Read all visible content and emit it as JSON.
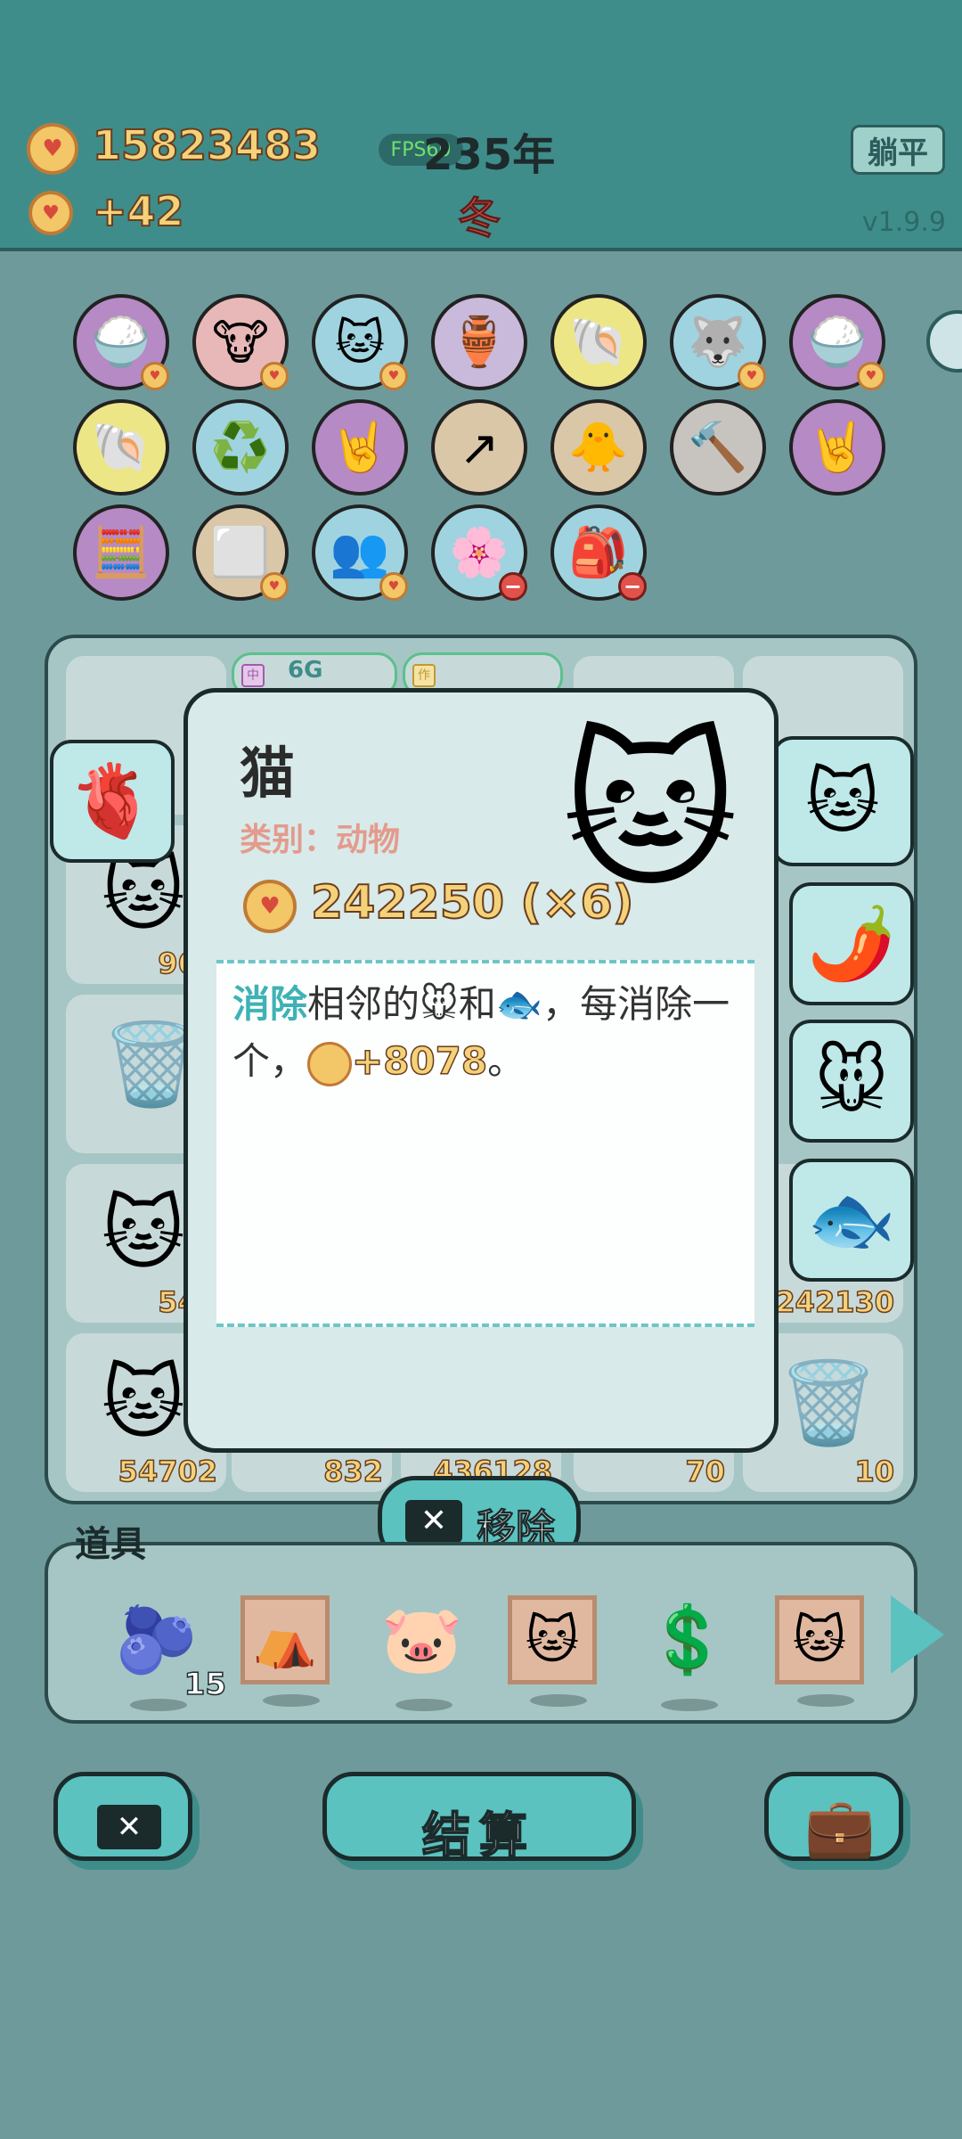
{
  "status": {
    "coins": "15823483",
    "income": "+42",
    "fps": "FPS60",
    "year": "235年",
    "season": "冬",
    "mode_button": "躺平",
    "version": "v1.9.9"
  },
  "inventory_rows": [
    [
      "🍚",
      "🐮",
      "🐱",
      "🏺",
      "🐚",
      "🐺",
      "🍚"
    ],
    [
      "🐚",
      "♻️",
      "🤘",
      "↗",
      "🐥",
      "🔨",
      "🤘"
    ],
    [
      "🧮",
      "⬜",
      "👥",
      "🌸",
      "🎒"
    ]
  ],
  "board": {
    "pill_labels": [
      "6G",
      "作"
    ],
    "cell_numbers": [
      "967",
      "546",
      "242130",
      "54702",
      "832",
      "436128",
      "70",
      "10"
    ]
  },
  "targets": [
    "🫀",
    "🐱",
    "🌶️",
    "🐭",
    "🐟"
  ],
  "popup": {
    "title": "猫",
    "category": "类别：动物",
    "value": "242250 (×6)",
    "desc_highlight": "消除",
    "desc_part1": "相邻的",
    "desc_mouse": "🐭",
    "desc_and": "和",
    "desc_fish": "🐟",
    "desc_part2": "，每消除一个，",
    "desc_bonus": "+8078",
    "desc_end": "。"
  },
  "remove_button": "移除",
  "tools": {
    "label": "道具",
    "blueberry_count": "15"
  },
  "bottom": {
    "settle_label": "结算"
  }
}
